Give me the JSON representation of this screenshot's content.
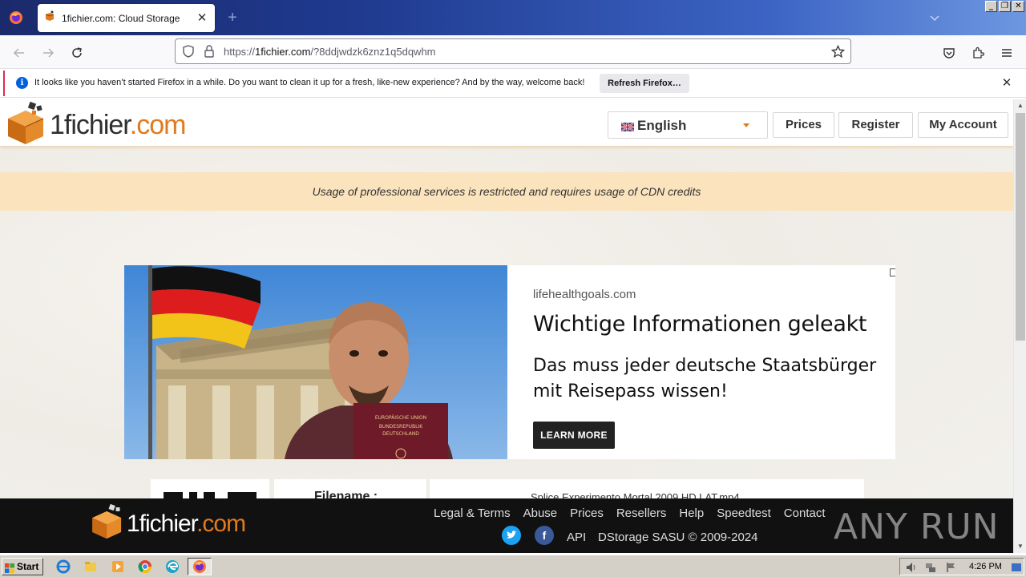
{
  "browser": {
    "tab_title": "1fichier.com: Cloud Storage",
    "url_prefix": "https://",
    "url_domain": "1fichier.com",
    "url_path": "/?8ddjwdzk6znz1q5dqwhm",
    "notification": {
      "message": "It looks like you haven’t started Firefox in a while. Do you want to clean it up for a fresh, like-new experience? And by the way, welcome back!",
      "button": "Refresh Firefox…"
    }
  },
  "site": {
    "logo_main": "1fichier",
    "logo_dot": ".",
    "logo_com": "com",
    "language": "English",
    "nav": [
      "Prices",
      "Register",
      "My Account"
    ],
    "notice": "Usage of professional services is restricted and requires usage of CDN credits",
    "filename_label": "Filename :",
    "filename_value": "Splice Experimento Mortal 2009 HD LAT.mp4"
  },
  "ad": {
    "domain": "lifehealthgoals.com",
    "headline": "Wichtige Informationen geleakt",
    "body": "Das muss jeder deutsche Staatsbürger mit Reisepass wissen!",
    "cta": "LEARN MORE",
    "passport_line1": "EUROPÄISCHE UNION",
    "passport_line2": "BUNDESREPUBLIK",
    "passport_line3": "DEUTSCHLAND"
  },
  "footer": {
    "links": [
      "Legal & Terms",
      "Abuse",
      "Prices",
      "Resellers",
      "Help",
      "Speedtest",
      "Contact"
    ],
    "api": "API",
    "copyright": "DStorage SASU © 2009-2024"
  },
  "watermark": "ANY RUN",
  "taskbar": {
    "start": "Start",
    "clock": "4:26 PM"
  },
  "colors": {
    "brand_orange": "#e07b1e",
    "notice_bg": "#fbe3bd",
    "footer_bg": "#111111"
  }
}
